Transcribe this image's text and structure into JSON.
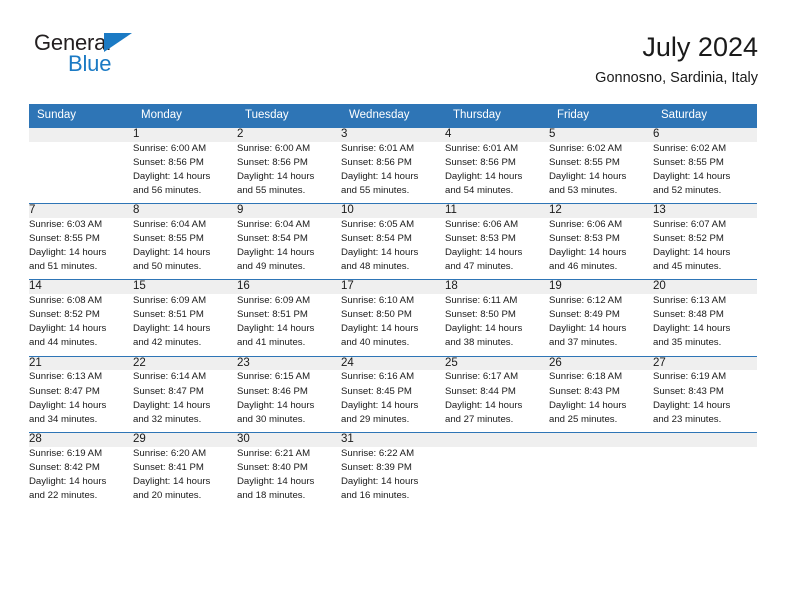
{
  "brand": {
    "name_dark": "General",
    "name_blue": "Blue",
    "accent_color": "#1b7ac4"
  },
  "header": {
    "title": "July 2024",
    "location": "Gonnosno, Sardinia, Italy",
    "header_bg_color": "#2e75b6",
    "daynum_bg_color": "#efefef"
  },
  "weekdays": [
    "Sunday",
    "Monday",
    "Tuesday",
    "Wednesday",
    "Thursday",
    "Friday",
    "Saturday"
  ],
  "weeks": [
    [
      {
        "day": "",
        "lines": []
      },
      {
        "day": "1",
        "lines": [
          "Sunrise: 6:00 AM",
          "Sunset: 8:56 PM",
          "Daylight: 14 hours",
          "and 56 minutes."
        ]
      },
      {
        "day": "2",
        "lines": [
          "Sunrise: 6:00 AM",
          "Sunset: 8:56 PM",
          "Daylight: 14 hours",
          "and 55 minutes."
        ]
      },
      {
        "day": "3",
        "lines": [
          "Sunrise: 6:01 AM",
          "Sunset: 8:56 PM",
          "Daylight: 14 hours",
          "and 55 minutes."
        ]
      },
      {
        "day": "4",
        "lines": [
          "Sunrise: 6:01 AM",
          "Sunset: 8:56 PM",
          "Daylight: 14 hours",
          "and 54 minutes."
        ]
      },
      {
        "day": "5",
        "lines": [
          "Sunrise: 6:02 AM",
          "Sunset: 8:55 PM",
          "Daylight: 14 hours",
          "and 53 minutes."
        ]
      },
      {
        "day": "6",
        "lines": [
          "Sunrise: 6:02 AM",
          "Sunset: 8:55 PM",
          "Daylight: 14 hours",
          "and 52 minutes."
        ]
      }
    ],
    [
      {
        "day": "7",
        "lines": [
          "Sunrise: 6:03 AM",
          "Sunset: 8:55 PM",
          "Daylight: 14 hours",
          "and 51 minutes."
        ]
      },
      {
        "day": "8",
        "lines": [
          "Sunrise: 6:04 AM",
          "Sunset: 8:55 PM",
          "Daylight: 14 hours",
          "and 50 minutes."
        ]
      },
      {
        "day": "9",
        "lines": [
          "Sunrise: 6:04 AM",
          "Sunset: 8:54 PM",
          "Daylight: 14 hours",
          "and 49 minutes."
        ]
      },
      {
        "day": "10",
        "lines": [
          "Sunrise: 6:05 AM",
          "Sunset: 8:54 PM",
          "Daylight: 14 hours",
          "and 48 minutes."
        ]
      },
      {
        "day": "11",
        "lines": [
          "Sunrise: 6:06 AM",
          "Sunset: 8:53 PM",
          "Daylight: 14 hours",
          "and 47 minutes."
        ]
      },
      {
        "day": "12",
        "lines": [
          "Sunrise: 6:06 AM",
          "Sunset: 8:53 PM",
          "Daylight: 14 hours",
          "and 46 minutes."
        ]
      },
      {
        "day": "13",
        "lines": [
          "Sunrise: 6:07 AM",
          "Sunset: 8:52 PM",
          "Daylight: 14 hours",
          "and 45 minutes."
        ]
      }
    ],
    [
      {
        "day": "14",
        "lines": [
          "Sunrise: 6:08 AM",
          "Sunset: 8:52 PM",
          "Daylight: 14 hours",
          "and 44 minutes."
        ]
      },
      {
        "day": "15",
        "lines": [
          "Sunrise: 6:09 AM",
          "Sunset: 8:51 PM",
          "Daylight: 14 hours",
          "and 42 minutes."
        ]
      },
      {
        "day": "16",
        "lines": [
          "Sunrise: 6:09 AM",
          "Sunset: 8:51 PM",
          "Daylight: 14 hours",
          "and 41 minutes."
        ]
      },
      {
        "day": "17",
        "lines": [
          "Sunrise: 6:10 AM",
          "Sunset: 8:50 PM",
          "Daylight: 14 hours",
          "and 40 minutes."
        ]
      },
      {
        "day": "18",
        "lines": [
          "Sunrise: 6:11 AM",
          "Sunset: 8:50 PM",
          "Daylight: 14 hours",
          "and 38 minutes."
        ]
      },
      {
        "day": "19",
        "lines": [
          "Sunrise: 6:12 AM",
          "Sunset: 8:49 PM",
          "Daylight: 14 hours",
          "and 37 minutes."
        ]
      },
      {
        "day": "20",
        "lines": [
          "Sunrise: 6:13 AM",
          "Sunset: 8:48 PM",
          "Daylight: 14 hours",
          "and 35 minutes."
        ]
      }
    ],
    [
      {
        "day": "21",
        "lines": [
          "Sunrise: 6:13 AM",
          "Sunset: 8:47 PM",
          "Daylight: 14 hours",
          "and 34 minutes."
        ]
      },
      {
        "day": "22",
        "lines": [
          "Sunrise: 6:14 AM",
          "Sunset: 8:47 PM",
          "Daylight: 14 hours",
          "and 32 minutes."
        ]
      },
      {
        "day": "23",
        "lines": [
          "Sunrise: 6:15 AM",
          "Sunset: 8:46 PM",
          "Daylight: 14 hours",
          "and 30 minutes."
        ]
      },
      {
        "day": "24",
        "lines": [
          "Sunrise: 6:16 AM",
          "Sunset: 8:45 PM",
          "Daylight: 14 hours",
          "and 29 minutes."
        ]
      },
      {
        "day": "25",
        "lines": [
          "Sunrise: 6:17 AM",
          "Sunset: 8:44 PM",
          "Daylight: 14 hours",
          "and 27 minutes."
        ]
      },
      {
        "day": "26",
        "lines": [
          "Sunrise: 6:18 AM",
          "Sunset: 8:43 PM",
          "Daylight: 14 hours",
          "and 25 minutes."
        ]
      },
      {
        "day": "27",
        "lines": [
          "Sunrise: 6:19 AM",
          "Sunset: 8:43 PM",
          "Daylight: 14 hours",
          "and 23 minutes."
        ]
      }
    ],
    [
      {
        "day": "28",
        "lines": [
          "Sunrise: 6:19 AM",
          "Sunset: 8:42 PM",
          "Daylight: 14 hours",
          "and 22 minutes."
        ]
      },
      {
        "day": "29",
        "lines": [
          "Sunrise: 6:20 AM",
          "Sunset: 8:41 PM",
          "Daylight: 14 hours",
          "and 20 minutes."
        ]
      },
      {
        "day": "30",
        "lines": [
          "Sunrise: 6:21 AM",
          "Sunset: 8:40 PM",
          "Daylight: 14 hours",
          "and 18 minutes."
        ]
      },
      {
        "day": "31",
        "lines": [
          "Sunrise: 6:22 AM",
          "Sunset: 8:39 PM",
          "Daylight: 14 hours",
          "and 16 minutes."
        ]
      },
      {
        "day": "",
        "lines": []
      },
      {
        "day": "",
        "lines": []
      },
      {
        "day": "",
        "lines": []
      }
    ]
  ]
}
